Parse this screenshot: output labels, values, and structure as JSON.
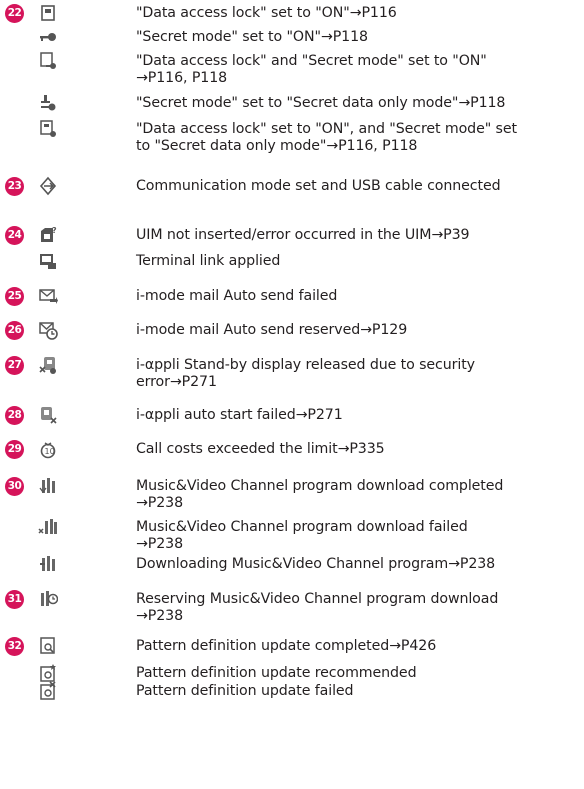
{
  "colors": {
    "number_badge": "#d5145a",
    "text": "#231f20",
    "icon": "#555555"
  },
  "entries": [
    {
      "num": "22",
      "icon": "lock-icon",
      "text": "\"Data access lock\" set to \"ON\"→P116"
    },
    {
      "icon": "key-icon",
      "text": "\"Secret mode\" set to \"ON\"→P118"
    },
    {
      "icon": "lock-key-icon",
      "text": "\"Data access lock\" and \"Secret mode\" set to \"ON\"\n→P116, P118"
    },
    {
      "icon": "secret-data-icon",
      "text": "\"Secret mode\" set to \"Secret data only mode\"→P118"
    },
    {
      "icon": "lock-secret-data-icon",
      "text": "\"Data access lock\" set to \"ON\", and \"Secret mode\" set\nto \"Secret data only mode\"→P116, P118"
    },
    {
      "num": "23",
      "icon": "usb-communication-icon",
      "text": "Communication mode set and USB cable connected"
    },
    {
      "num": "24",
      "icon": "uim-error-icon",
      "text": "UIM not inserted/error occurred in the UIM→P39"
    },
    {
      "icon": "terminal-link-icon",
      "text": "Terminal link applied"
    },
    {
      "num": "25",
      "icon": "mail-send-failed-icon",
      "text": "i-mode mail Auto send failed"
    },
    {
      "num": "26",
      "icon": "mail-send-reserved-icon",
      "text": "i-mode mail Auto send reserved→P129"
    },
    {
      "num": "27",
      "icon": "iappli-security-error-icon",
      "text": "i-αppli Stand-by display released due to security\nerror→P271"
    },
    {
      "num": "28",
      "icon": "iappli-autostart-failed-icon",
      "text": "i-αppli auto start failed→P271"
    },
    {
      "num": "29",
      "icon": "call-cost-icon",
      "text": "Call costs exceeded the limit→P335"
    },
    {
      "num": "30",
      "icon": "channel-download-completed-icon",
      "text": "Music&Video Channel program download completed\n→P238"
    },
    {
      "icon": "channel-download-failed-icon",
      "text": "Music&Video Channel program download failed\n→P238"
    },
    {
      "icon": "channel-downloading-icon",
      "text": "Downloading Music&Video Channel program→P238"
    },
    {
      "num": "31",
      "icon": "channel-reserve-icon",
      "text": "Reserving Music&Video Channel program download\n→P238"
    },
    {
      "num": "32",
      "icon": "pattern-update-completed-icon",
      "text": "Pattern definition update completed→P426"
    },
    {
      "icon": "pattern-update-recommended-icon",
      "text": "Pattern definition update recommended"
    },
    {
      "icon": "pattern-update-failed-icon",
      "text": "Pattern definition update failed"
    }
  ]
}
